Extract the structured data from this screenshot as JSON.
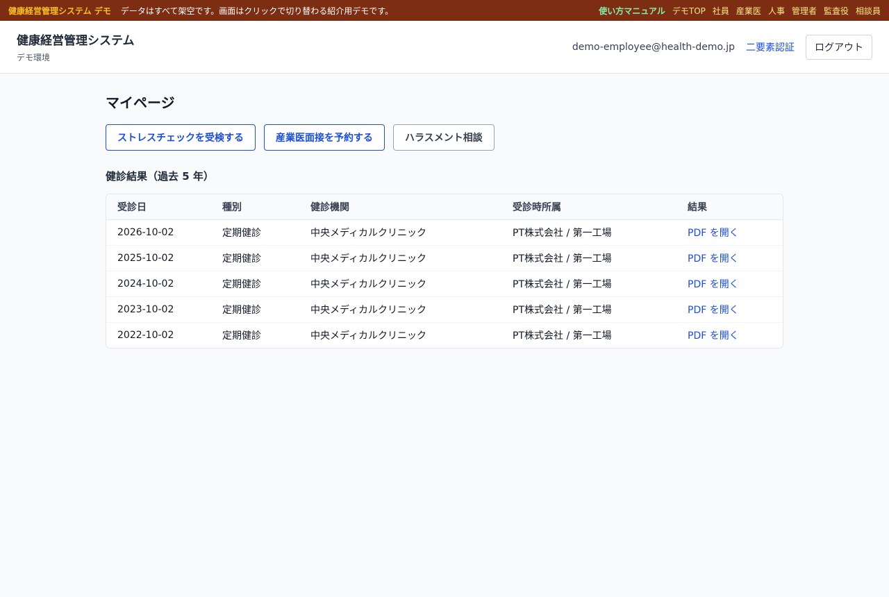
{
  "demo_bar": {
    "title": "健康経営管理システム デモ",
    "notice": "データはすべて架空です。画面はクリックで切り替わる紹介用デモです。",
    "links": [
      {
        "label": "使い方マニュアル"
      },
      {
        "label": "デモTOP"
      },
      {
        "label": "社員"
      },
      {
        "label": "産業医"
      },
      {
        "label": "人事"
      },
      {
        "label": "管理者"
      },
      {
        "label": "監査役"
      },
      {
        "label": "相談員"
      }
    ]
  },
  "header": {
    "title": "健康経営管理システム",
    "subtitle": "デモ環境",
    "user_email": "demo-employee@health-demo.jp",
    "mfa_label": "二要素認証",
    "logout_label": "ログアウト"
  },
  "main": {
    "page_title": "マイページ",
    "actions": [
      {
        "label": "ストレスチェックを受検する"
      },
      {
        "label": "産業医面接を予約する"
      },
      {
        "label": "ハラスメント相談"
      }
    ],
    "section_title": "健診結果（過去 5 年）",
    "table": {
      "headers": [
        "受診日",
        "種別",
        "健診機関",
        "受診時所属",
        "結果"
      ],
      "rows": [
        [
          "2026-10-02",
          "定期健診",
          "中央メディカルクリニック",
          "PT株式会社 / 第一工場",
          "PDF を開く"
        ],
        [
          "2025-10-02",
          "定期健診",
          "中央メディカルクリニック",
          "PT株式会社 / 第一工場",
          "PDF を開く"
        ],
        [
          "2024-10-02",
          "定期健診",
          "中央メディカルクリニック",
          "PT株式会社 / 第一工場",
          "PDF を開く"
        ],
        [
          "2023-10-02",
          "定期健診",
          "中央メディカルクリニック",
          "PT株式会社 / 第一工場",
          "PDF を開く"
        ],
        [
          "2022-10-02",
          "定期健診",
          "中央メディカルクリニック",
          "PT株式会社 / 第一工場",
          "PDF を開く"
        ]
      ]
    }
  },
  "colors": {
    "demo_bar_bg": "#7c2d12",
    "demo_title": "#fbbf24",
    "manual_link": "#86efac",
    "link_blue": "#1d4ed8",
    "page_bg": "#f8fafc"
  }
}
